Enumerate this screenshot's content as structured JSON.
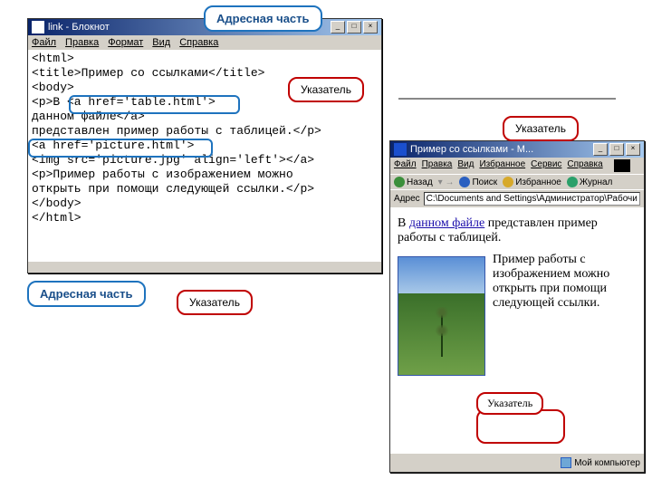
{
  "notepad": {
    "title": "link - Блокнот",
    "menu": [
      "Файл",
      "Правка",
      "Формат",
      "Вид",
      "Справка"
    ],
    "code_lines": [
      "<html>",
      "<title>Пример со ссылками</title>",
      "<body>",
      "<p>В <a href='table.html'>",
      "данном файле</a>",
      "представлен пример работы с таблицей.</p>",
      "<a href='picture.html'>",
      "<img src='picture.jpg' align='left'></a>",
      "<p>Пример работы с изображением можно",
      "открыть при помощи следующей ссылки.</p>",
      "</body>",
      "</html>"
    ]
  },
  "browser": {
    "title": "Пример со ссылками - M...",
    "menu": [
      "Файл",
      "Правка",
      "Вид",
      "Избранное",
      "Сервис",
      "Справка"
    ],
    "nav": {
      "back": "Назад",
      "search": "Поиск",
      "fav": "Избранное",
      "journal": "Журнал"
    },
    "address_label": "Адрес",
    "address_value": "C:\\Documents and Settings\\Администратор\\Рабочий стол\\demo\\link.ht",
    "body_prefix": "В ",
    "body_link": "данном файле",
    "body_after": " представлен пример работы с таблицей.",
    "body_p2": "Пример работы с изображением можно открыть при помощи следующей ссылки.",
    "status": "Мой компьютер"
  },
  "labels": {
    "address_part": "Адресная часть",
    "pointer": "Указатель"
  }
}
